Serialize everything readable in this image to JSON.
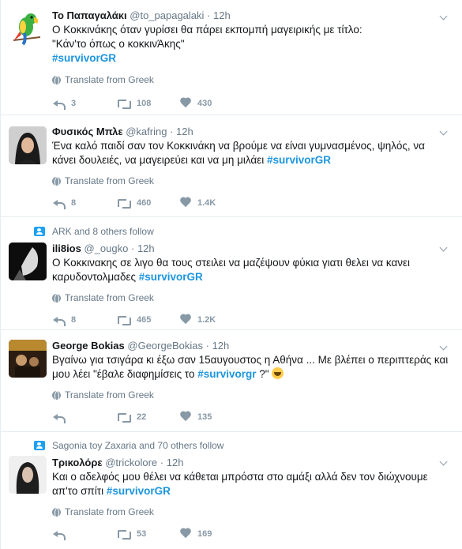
{
  "tweets": [
    {
      "social": "",
      "name": "Το Παπαγαλάκι",
      "handle": "@to_papagalaki",
      "time": "12h",
      "text_before": "Ο Κοκκινάκης όταν γυρίσει θα πάρει εκπομπή μαγειρικής με τίτλο:\n\"Κάν'το όπως ο κοκκινΆκης\"\n",
      "hashtag": "#survivorGR",
      "text_after": "",
      "translate": "Translate from Greek",
      "replies": "3",
      "retweets": "108",
      "likes": "430"
    },
    {
      "social": "",
      "name": "Φυσικός Μπλε",
      "handle": "@kafring",
      "time": "12h",
      "text_before": "Ένα καλό παιδί σαν τον Κοκκινάκη να βρούμε να είναι γυμνασμένος, ψηλός, να κάνει δουλειές, να μαγειρεύει και να μη μιλάει ",
      "hashtag": "#survivorGR",
      "text_after": "",
      "translate": "Translate from Greek",
      "replies": "8",
      "retweets": "460",
      "likes": "1.4K"
    },
    {
      "social": "ARK and 8 others follow",
      "name": "ili8ios",
      "handle": "@_ougko",
      "time": "12h",
      "text_before": "Ο Κοκκινακης σε λιγο θα τους στειλει να μαζέψουν φύκια γιατι θελει να κανει καρυδοντολμαδες ",
      "hashtag": "#survivorGR",
      "text_after": "",
      "translate": "Translate from Greek",
      "replies": "8",
      "retweets": "465",
      "likes": "1.2K"
    },
    {
      "social": "",
      "name": "George Bokias",
      "handle": "@GeorgeBokias",
      "time": "12h",
      "text_before": "Βγαίνω για τσιγάρα κι έξω σαν 15αυγουστος η Αθήνα ... Με βλέπει ο περιπτεράς και μου λέει \"έβαλε διαφημίσεις το ",
      "hashtag": "#survivorgr",
      "text_after": " ?\" ",
      "translate": "Translate from Greek",
      "replies": "",
      "retweets": "22",
      "likes": "135"
    },
    {
      "social": "Sagonia toy Zaxaria and 70 others follow",
      "name": "Τρικολόρε",
      "handle": "@trickolore",
      "time": "12h",
      "text_before": "Και ο αδελφός μου θέλει να κάθεται μπρόστα στο αμάξι αλλά δεν τον διώχνουμε απ'το σπίτι ",
      "hashtag": "#survivorGR",
      "text_after": "",
      "translate": "Translate from Greek",
      "replies": "",
      "retweets": "53",
      "likes": "169"
    }
  ],
  "colors": {
    "hashtag": "#1b95e0",
    "muted": "#657786",
    "icon": "#8899a6"
  }
}
